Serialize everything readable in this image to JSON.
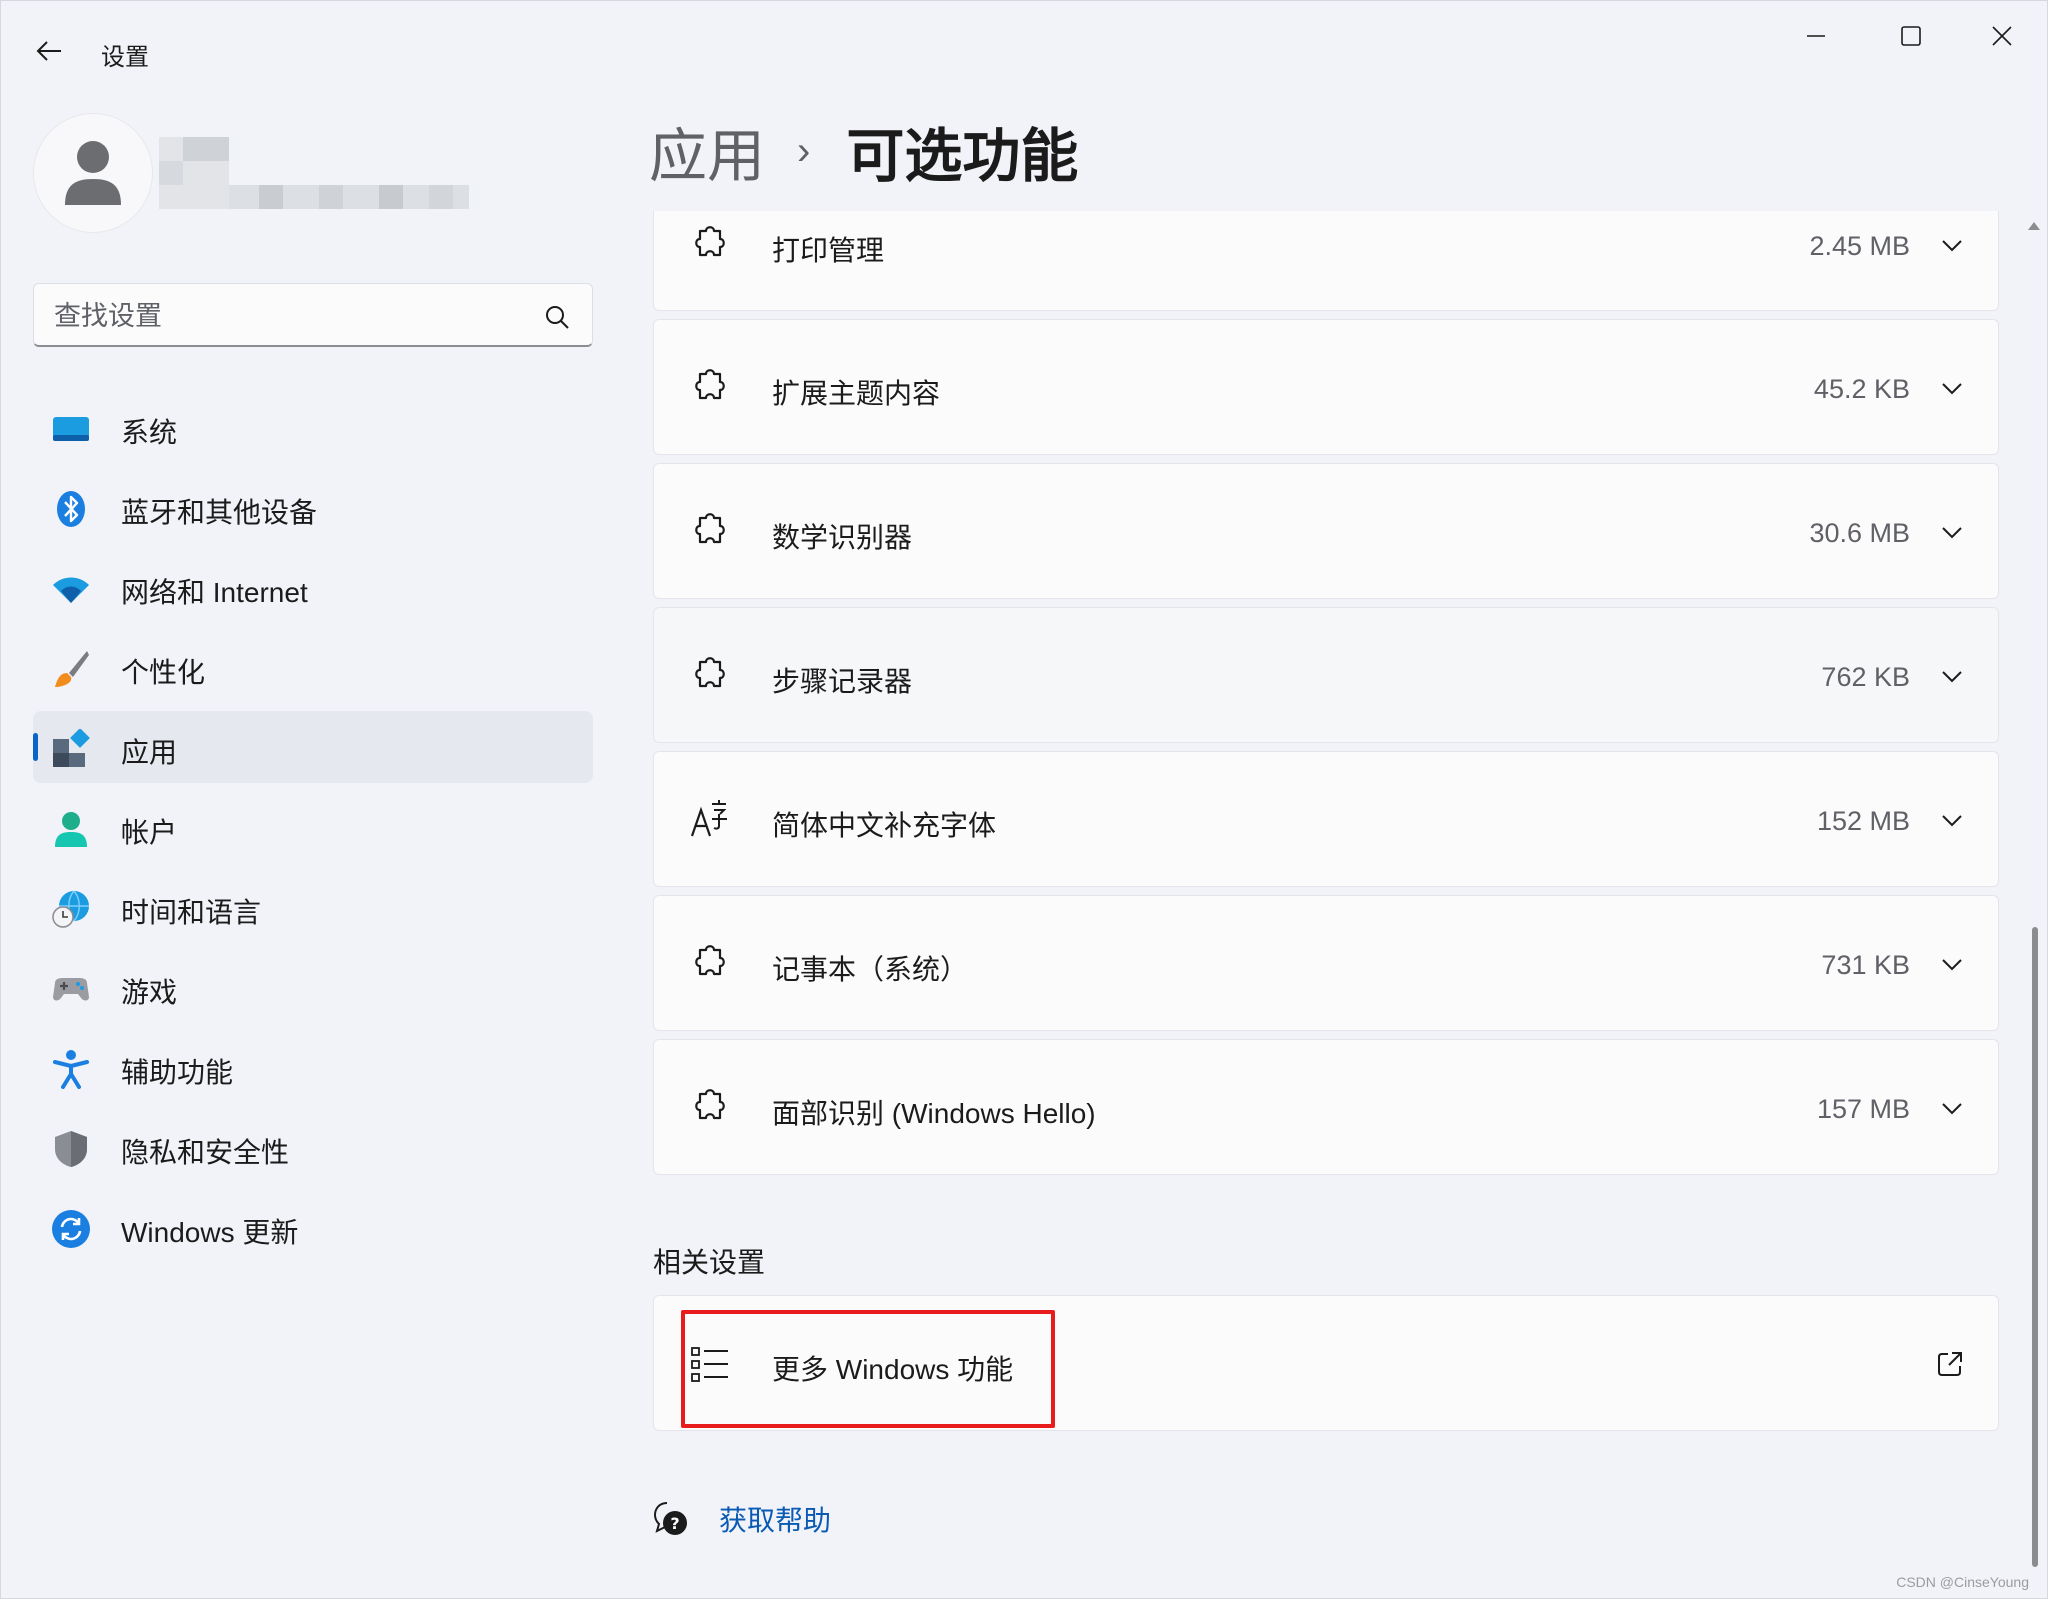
{
  "window": {
    "title": "设置"
  },
  "search": {
    "placeholder": "查找设置"
  },
  "sidebar": {
    "items": [
      {
        "label": "系统",
        "icon": "system-monitor-icon"
      },
      {
        "label": "蓝牙和其他设备",
        "icon": "bluetooth-icon"
      },
      {
        "label": "网络和 Internet",
        "icon": "wifi-icon"
      },
      {
        "label": "个性化",
        "icon": "paintbrush-icon"
      },
      {
        "label": "应用",
        "icon": "apps-icon",
        "active": true
      },
      {
        "label": "帐户",
        "icon": "account-icon"
      },
      {
        "label": "时间和语言",
        "icon": "globe-clock-icon"
      },
      {
        "label": "游戏",
        "icon": "gamepad-icon"
      },
      {
        "label": "辅助功能",
        "icon": "accessibility-icon"
      },
      {
        "label": "隐私和安全性",
        "icon": "shield-icon"
      },
      {
        "label": "Windows 更新",
        "icon": "windows-update-icon"
      }
    ]
  },
  "breadcrumb": {
    "parent": "应用",
    "separator": "›",
    "current": "可选功能"
  },
  "features": [
    {
      "name": "打印管理",
      "size": "2.45 MB",
      "icon": "puzzle-icon"
    },
    {
      "name": "扩展主题内容",
      "size": "45.2 KB",
      "icon": "puzzle-icon"
    },
    {
      "name": "数学识别器",
      "size": "30.6 MB",
      "icon": "puzzle-icon"
    },
    {
      "name": "步骤记录器",
      "size": "762 KB",
      "icon": "puzzle-icon"
    },
    {
      "name": "简体中文补充字体",
      "size": "152 MB",
      "icon": "font-icon"
    },
    {
      "name": "记事本（系统）",
      "size": "731 KB",
      "icon": "puzzle-icon"
    },
    {
      "name": "面部识别 (Windows Hello)",
      "size": "157 MB",
      "icon": "puzzle-icon"
    }
  ],
  "related": {
    "title": "相关设置",
    "more_features_label": "更多 Windows 功能"
  },
  "help": {
    "label": "获取帮助"
  },
  "watermark": "CSDN @CinseYoung",
  "colors": {
    "accent": "#0a63c9",
    "highlight_box": "#e81c1c",
    "link": "#0a5ab3"
  }
}
